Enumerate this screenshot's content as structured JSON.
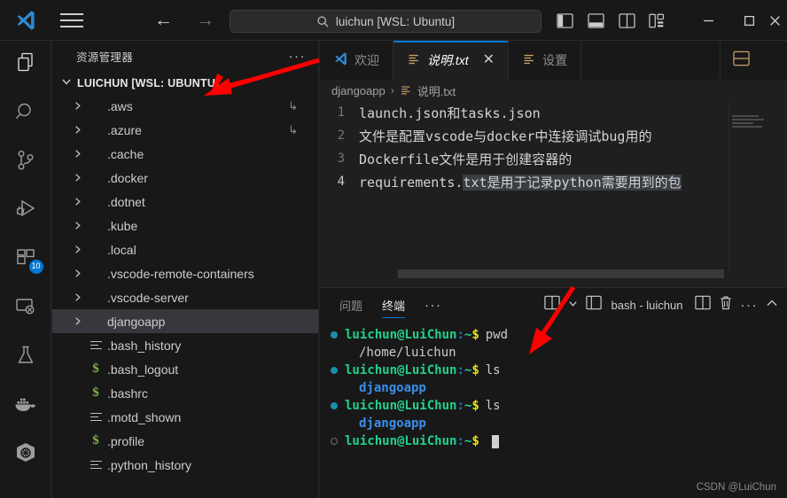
{
  "titlebar": {
    "search_value": "luichun [WSL: Ubuntu]",
    "back_icon": "arrow-left-icon",
    "forward_icon": "arrow-right-icon",
    "menu_icon": "hamburger-menu-icon",
    "logo_icon": "vscode-logo-icon",
    "layout_icons": [
      "toggle-primary-sidebar-icon",
      "toggle-panel-icon",
      "toggle-secondary-sidebar-icon",
      "customize-layout-icon"
    ],
    "window_controls": [
      "minimize",
      "maximize",
      "close"
    ]
  },
  "activitybar": {
    "items": [
      {
        "name": "explorer",
        "icon": "files-icon",
        "active": true,
        "badge": ""
      },
      {
        "name": "search",
        "icon": "search-icon",
        "active": false,
        "badge": ""
      },
      {
        "name": "source-control",
        "icon": "source-control-icon",
        "active": false,
        "badge": ""
      },
      {
        "name": "run-and-debug",
        "icon": "run-debug-icon",
        "active": false,
        "badge": ""
      },
      {
        "name": "extensions",
        "icon": "extensions-icon",
        "active": false,
        "badge": "10"
      },
      {
        "name": "remote-explorer",
        "icon": "remote-explorer-icon",
        "active": false,
        "badge": ""
      },
      {
        "name": "testing",
        "icon": "beaker-icon",
        "active": false,
        "badge": ""
      },
      {
        "name": "docker",
        "icon": "docker-whale-icon",
        "active": false,
        "badge": ""
      },
      {
        "name": "kubernetes",
        "icon": "kubernetes-helm-icon",
        "active": false,
        "badge": ""
      }
    ]
  },
  "sidebar": {
    "title": "资源管理器",
    "more_actions": "···",
    "root_label": "LUICHUN [WSL: UBUNTU]",
    "root_expanded": true,
    "tree": [
      {
        "label": ".aws",
        "type": "folder",
        "expanded": false,
        "symlink": "↳",
        "selected": false
      },
      {
        "label": ".azure",
        "type": "folder",
        "expanded": false,
        "symlink": "↳",
        "selected": false
      },
      {
        "label": ".cache",
        "type": "folder",
        "expanded": false,
        "symlink": "",
        "selected": false
      },
      {
        "label": ".docker",
        "type": "folder",
        "expanded": false,
        "symlink": "",
        "selected": false
      },
      {
        "label": ".dotnet",
        "type": "folder",
        "expanded": false,
        "symlink": "",
        "selected": false
      },
      {
        "label": ".kube",
        "type": "folder",
        "expanded": false,
        "symlink": "",
        "selected": false
      },
      {
        "label": ".local",
        "type": "folder",
        "expanded": false,
        "symlink": "",
        "selected": false
      },
      {
        "label": ".vscode-remote-containers",
        "type": "folder",
        "expanded": false,
        "symlink": "",
        "selected": false
      },
      {
        "label": ".vscode-server",
        "type": "folder",
        "expanded": false,
        "symlink": "",
        "selected": false
      },
      {
        "label": "djangoapp",
        "type": "folder",
        "expanded": false,
        "symlink": "",
        "selected": true
      },
      {
        "label": ".bash_history",
        "type": "text-file",
        "expanded": false,
        "symlink": "",
        "selected": false
      },
      {
        "label": ".bash_logout",
        "type": "shell-file",
        "expanded": false,
        "symlink": "",
        "selected": false
      },
      {
        "label": ".bashrc",
        "type": "shell-file",
        "expanded": false,
        "symlink": "",
        "selected": false
      },
      {
        "label": ".motd_shown",
        "type": "text-file",
        "expanded": false,
        "symlink": "",
        "selected": false
      },
      {
        "label": ".profile",
        "type": "shell-file",
        "expanded": false,
        "symlink": "",
        "selected": false
      },
      {
        "label": ".python_history",
        "type": "text-file",
        "expanded": false,
        "symlink": "",
        "selected": false
      }
    ]
  },
  "editor": {
    "tabs": [
      {
        "label": "欢迎",
        "icon": "vscode-logo-icon",
        "active": false,
        "preview": false,
        "closable": false
      },
      {
        "label": "说明.txt",
        "icon": "text-file-icon",
        "active": true,
        "preview": true,
        "closable": true,
        "close_glyph": "✕"
      },
      {
        "label": "设置",
        "icon": "text-file-icon",
        "active": false,
        "preview": false,
        "closable": false
      }
    ],
    "tabbar_action_icon": "split-editor-down-icon",
    "breadcrumb": {
      "folder": "djangoapp",
      "separator": "›",
      "file": "说明.txt",
      "file_icon": "text-file-icon"
    },
    "lines": [
      {
        "num": "1",
        "text": "launch.json和tasks.json",
        "active": false,
        "selected_text": ""
      },
      {
        "num": "2",
        "text": "文件是配置vscode与docker中连接调试bug用的",
        "active": false,
        "selected_text": ""
      },
      {
        "num": "3",
        "text": "Dockerfile文件是用于创建容器的",
        "active": false,
        "selected_text": ""
      },
      {
        "num": "4",
        "text": "requirements.txt是用于记录python需要用到的包",
        "active": true,
        "selected_text": "txt是用于记录python需要用到的包"
      }
    ]
  },
  "panel": {
    "tabs": [
      {
        "label": "问题",
        "active": false
      },
      {
        "label": "终端",
        "active": true
      }
    ],
    "more_tabs": "···",
    "actions": {
      "split_icon": "split-terminal-icon",
      "dropdown_icon": "chevron-down-icon",
      "terminal_selector_icon": "terminal-icon",
      "terminal_name": "bash - luichun",
      "split_right_icon": "split-terminal-icon",
      "kill_icon": "trash-icon",
      "more_icon": "more-actions-icon",
      "collapse_icon": "chevron-up-icon"
    },
    "terminal_lines": [
      {
        "kind": "prompt",
        "marker": "filled",
        "user": "luichun@LuiChun",
        "sep": ":",
        "path": "~",
        "dollar": "$",
        "command": "pwd"
      },
      {
        "kind": "output",
        "text": "/home/luichun",
        "style": "plain"
      },
      {
        "kind": "prompt",
        "marker": "filled",
        "user": "luichun@LuiChun",
        "sep": ":",
        "path": "~",
        "dollar": "$",
        "command": "ls"
      },
      {
        "kind": "output",
        "text": "djangoapp",
        "style": "dir"
      },
      {
        "kind": "prompt",
        "marker": "filled",
        "user": "luichun@LuiChun",
        "sep": ":",
        "path": "~",
        "dollar": "$",
        "command": "ls"
      },
      {
        "kind": "output",
        "text": "djangoapp",
        "style": "dir"
      },
      {
        "kind": "prompt",
        "marker": "hollow",
        "user": "luichun@LuiChun",
        "sep": ":",
        "path": "~",
        "dollar": "$",
        "command": "",
        "cursor": true
      }
    ]
  },
  "watermark": "CSDN @LuiChun",
  "colors": {
    "accent": "#0078d4",
    "titlebar_bg": "#181818",
    "editor_bg": "#1f1f1f",
    "selection": "#37373d",
    "terminal_green": "#23d18b",
    "terminal_blue": "#3b8eea",
    "terminal_yellow": "#e5e510",
    "annotation_red": "#ff0000",
    "badge_blue": "#0078d4",
    "shell_icon_green": "#7cb342"
  }
}
